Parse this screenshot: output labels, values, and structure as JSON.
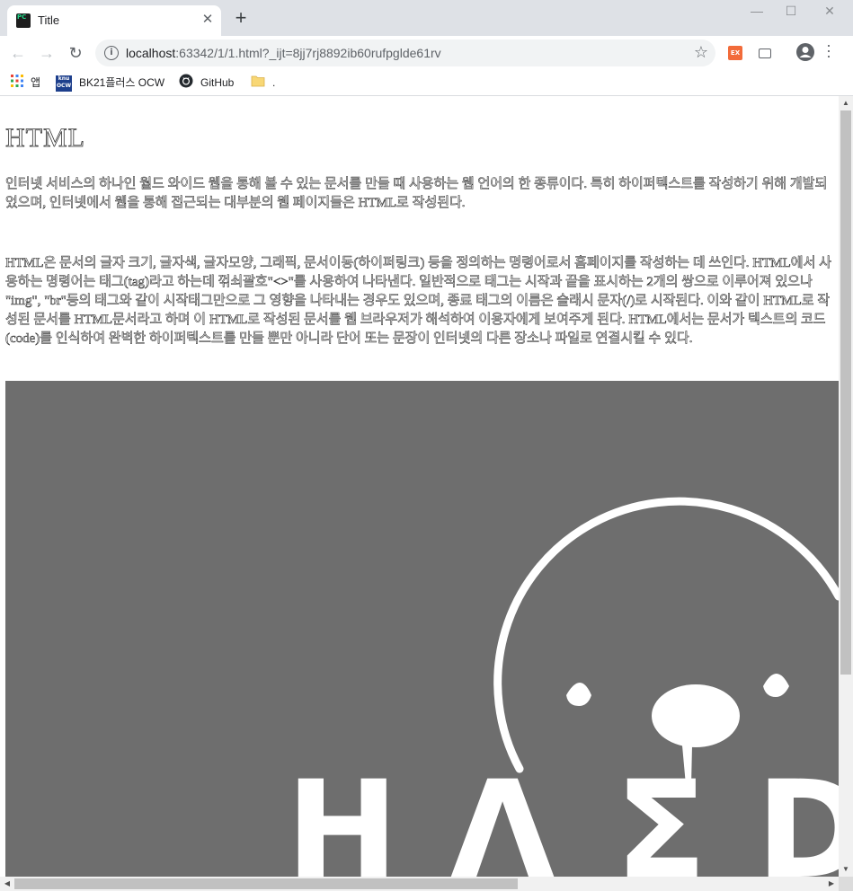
{
  "browser": {
    "tab_title": "Title",
    "tab_favicon_text": "PC",
    "new_tab_glyph": "+",
    "close_glyph": "✕",
    "url_host": "localhost",
    "url_rest": ":63342/1/1.html?_ijt=8jj7rj8892ib60rufpglde61rv",
    "bookmarks": [
      {
        "label": "앱",
        "icon": "apps-grid-icon"
      },
      {
        "label": "BK21플러스 OCW",
        "icon": "knu-ocw-icon",
        "icon_text": "knu\nOCW"
      },
      {
        "label": "GitHub",
        "icon": "github-icon"
      },
      {
        "label": ".",
        "icon": "folder-icon"
      }
    ],
    "extension_label": "EX"
  },
  "page": {
    "heading": "HTML",
    "paragraph1": "인터넷 서비스의 하나인 월드 와이드 웹을 통해 볼 수 있는 문서를 만들 때 사용하는 웹 언어의 한 종류이다. 특히 하이퍼텍스트를 작성하기 위해 개발되었으며, 인터넷에서 웹을 통해 접근되는 대부분의 웹 페이지들은 HTML로 작성된다.",
    "paragraph2": "HTML은 문서의 글자 크기, 글자색, 글자모양, 그래픽, 문서이동(하이퍼링크) 등을 정의하는 명령어로서 홈페이지를 작성하는 데 쓰인다. HTML에서 사용하는 명령어는 태그(tag)라고 하는데 꺾쇠괄호\"<>\"를 사용하여 나타낸다. 일반적으로 태그는 시작과 끝을 표시하는 2개의 쌍으로 이루어져 있으나 \"img\", \"br\"등의 태그와 같이 시작태그만으로 그 영향을 나타내는 경우도 있으며, 종료 태그의 이름은 슬래시 문자(/)로 시작된다. 이와 같이 HTML로 작성된 문서를 HTML문서라고 하며 이 HTML로 작성된 문서를 웹 브라우저가 해석하여 이용자에게 보여주게 된다. HTML에서는 문서가 텍스트의 코드(code)를 인식하여 완벽한 하이퍼텍스트를 만들 뿐만 아니라 단어 또는 문장이 인터넷의 다른 장소나 파일로 연결시킬 수 있다.",
    "hero_letters": [
      "H",
      "Λ",
      "Σ",
      "D"
    ]
  },
  "colors": {
    "hero_bg": "#6e6e6e",
    "hero_fg": "#ffffff",
    "tabstrip": "#dee1e6"
  }
}
